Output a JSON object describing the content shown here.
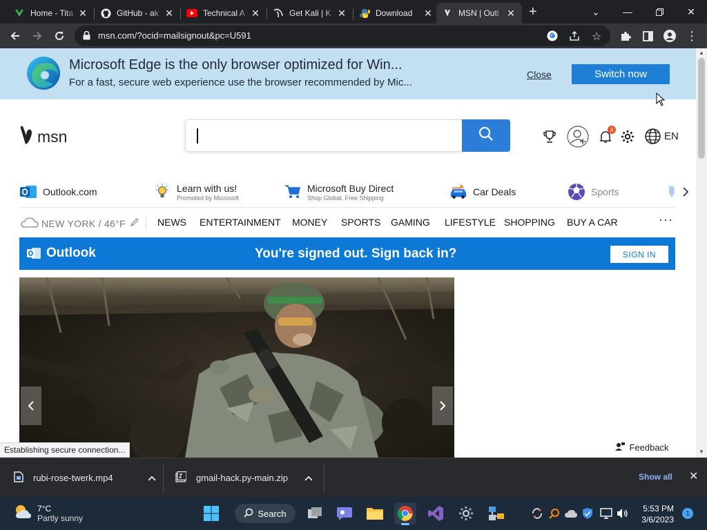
{
  "browser": {
    "tabs": [
      {
        "title": "Home - Tita",
        "icon": "titan-v-icon"
      },
      {
        "title": "GitHub - ak",
        "icon": "github-icon"
      },
      {
        "title": "Technical A",
        "icon": "youtube-icon"
      },
      {
        "title": "Get Kali | K",
        "icon": "kali-dragon-icon"
      },
      {
        "title": "Download",
        "icon": "python-icon"
      },
      {
        "title": "MSN | Outl",
        "icon": "msn-butterfly-icon",
        "active": true
      }
    ],
    "new_tab_label": "+",
    "url": "msn.com/?ocid=mailsignout&pc=U591"
  },
  "edge_banner": {
    "title": "Microsoft Edge is the only browser optimized for Win...",
    "subtitle": "For a fast, secure web experience use the browser recommended by Mic...",
    "close_label": "Close",
    "switch_label": "Switch now"
  },
  "msn_header": {
    "logo_text": "msn",
    "notification_count": "3",
    "language": "EN"
  },
  "quick_links": [
    {
      "title": "Outlook.com",
      "subtitle": "",
      "icon": "outlook-icon"
    },
    {
      "title": "Learn with us!",
      "subtitle": "Promoted by Microsoft",
      "icon": "lightbulb-icon"
    },
    {
      "title": "Microsoft Buy Direct",
      "subtitle": "Shop Global, Free Shipping",
      "icon": "cart-icon"
    },
    {
      "title": "Car Deals",
      "subtitle": "",
      "icon": "car-icon"
    },
    {
      "title": "Sports",
      "subtitle": "",
      "icon": "sports-icon"
    }
  ],
  "nav": {
    "weather": "NEW YORK / 46°F",
    "items": [
      "NEWS",
      "ENTERTAINMENT",
      "MONEY",
      "SPORTS",
      "GAMING",
      "LIFESTYLE",
      "SHOPPING",
      "BUY A CAR"
    ],
    "more": "···"
  },
  "outlook_bar": {
    "brand": "Outlook",
    "message": "You're signed out. Sign back in?",
    "sign_in": "SIGN IN"
  },
  "feedback_label": "Feedback",
  "status_text": "Establishing secure connection...",
  "downloads": {
    "items": [
      {
        "filename": "rubi-rose-twerk.mp4",
        "icon": "video-file-icon"
      },
      {
        "filename": "gmail-hack.py-main.zip",
        "icon": "zip-file-icon"
      }
    ],
    "show_all": "Show all"
  },
  "taskbar": {
    "weather_temp": "7°C",
    "weather_condition": "Partly sunny",
    "search_label": "Search",
    "time": "5:53 PM",
    "date": "3/6/2023",
    "notification_count": "1"
  },
  "colors": {
    "tab_strip": "#202124",
    "banner": "#c3dff2",
    "msn_blue": "#2c7dd8",
    "outlook_blue": "#0d78d6",
    "taskbar": "#1c2a3a"
  }
}
